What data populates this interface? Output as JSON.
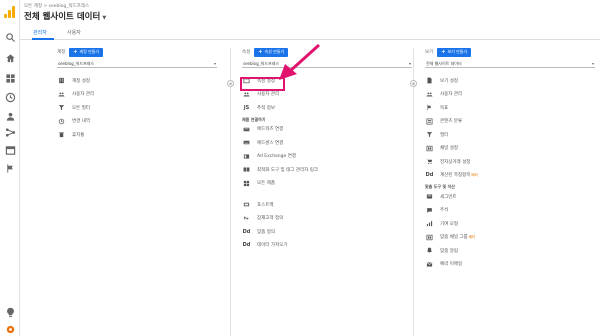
{
  "header": {
    "breadcrumb": "모든 계정 > seeblog_워드프레스",
    "title": "전체 웹사이트 데이터",
    "title_caret": "▼"
  },
  "tabs": [
    {
      "label": "관리자",
      "active": true
    },
    {
      "label": "사용자",
      "active": false
    }
  ],
  "nav_icons": [
    "search-icon",
    "home-icon",
    "dashboard-icon",
    "clock-icon",
    "person-icon",
    "acquisition-icon",
    "behavior-icon",
    "flag-icon",
    "lightbulb-icon",
    "gear-icon"
  ],
  "account": {
    "label": "계정",
    "create_label": "계정 만들기",
    "selector": "seeblog_워드프레스",
    "items": [
      {
        "icon": "building-icon",
        "label": "계정 설정"
      },
      {
        "icon": "users-icon",
        "label": "사용자 관리"
      },
      {
        "icon": "filter-icon",
        "label": "모든 필터"
      },
      {
        "icon": "history-icon",
        "label": "변경 내역"
      },
      {
        "icon": "trash-icon",
        "label": "휴지통"
      }
    ]
  },
  "property": {
    "label": "속성",
    "create_label": "속성 만들기",
    "selector": "seeblog_워드프레스",
    "items": [
      {
        "icon": "window-icon",
        "label": "속성 설정"
      },
      {
        "icon": "users-icon",
        "label": "사용자 관리"
      },
      {
        "icon": "js-icon",
        "label": "추적 정보"
      }
    ],
    "section": "제품 연결하기",
    "product_items": [
      {
        "icon": "ads-icon",
        "label": "애드워즈 연결"
      },
      {
        "icon": "adsense-icon",
        "label": "애드센스 연결"
      },
      {
        "icon": "adexchange-icon",
        "label": "Ad Exchange 연결"
      },
      {
        "icon": "products-icon",
        "label": "최적화 도구 및 태그 관리자 링크"
      },
      {
        "icon": "allproducts-icon",
        "label": "모든 제품"
      }
    ],
    "more_items": [
      {
        "icon": "postback-icon",
        "label": "포스트백"
      },
      {
        "icon": "audience-icon",
        "label": "잠재고객 정의"
      },
      {
        "icon": "dd-icon",
        "label": "맞춤 정의"
      },
      {
        "icon": "dd-icon",
        "label": "데이터 가져오기"
      }
    ]
  },
  "view": {
    "label": "보기",
    "create_label": "보기 만들기",
    "selector": "전체 웹사이트 데이터",
    "items": [
      {
        "icon": "doc-icon",
        "label": "보기 설정"
      },
      {
        "icon": "users-icon",
        "label": "사용자 관리"
      },
      {
        "icon": "flag-icon",
        "label": "목표"
      },
      {
        "icon": "content-icon",
        "label": "콘텐츠 분류"
      },
      {
        "icon": "filter-icon",
        "label": "필터"
      },
      {
        "icon": "channel-icon",
        "label": "채널 설정"
      },
      {
        "icon": "cart-icon",
        "label": "전자상거래 설정"
      },
      {
        "icon": "dd-icon",
        "label": "계산된 측정항목",
        "badge": "베타"
      }
    ],
    "section": "맞춤 도구 및 자산",
    "tool_items": [
      {
        "icon": "segment-icon",
        "label": "세그먼트"
      },
      {
        "icon": "note-icon",
        "label": "주석"
      },
      {
        "icon": "attribution-icon",
        "label": "기여 모형"
      },
      {
        "icon": "channel-icon",
        "label": "맞춤 채널 그룹",
        "badge": "베타"
      },
      {
        "icon": "alert-icon",
        "label": "맞춤 알림"
      },
      {
        "icon": "email-icon",
        "label": "예약 이메일"
      }
    ]
  },
  "colors": {
    "accent": "#1a73e8",
    "highlight": "#e2136e",
    "active_nav": "#e8710a"
  }
}
